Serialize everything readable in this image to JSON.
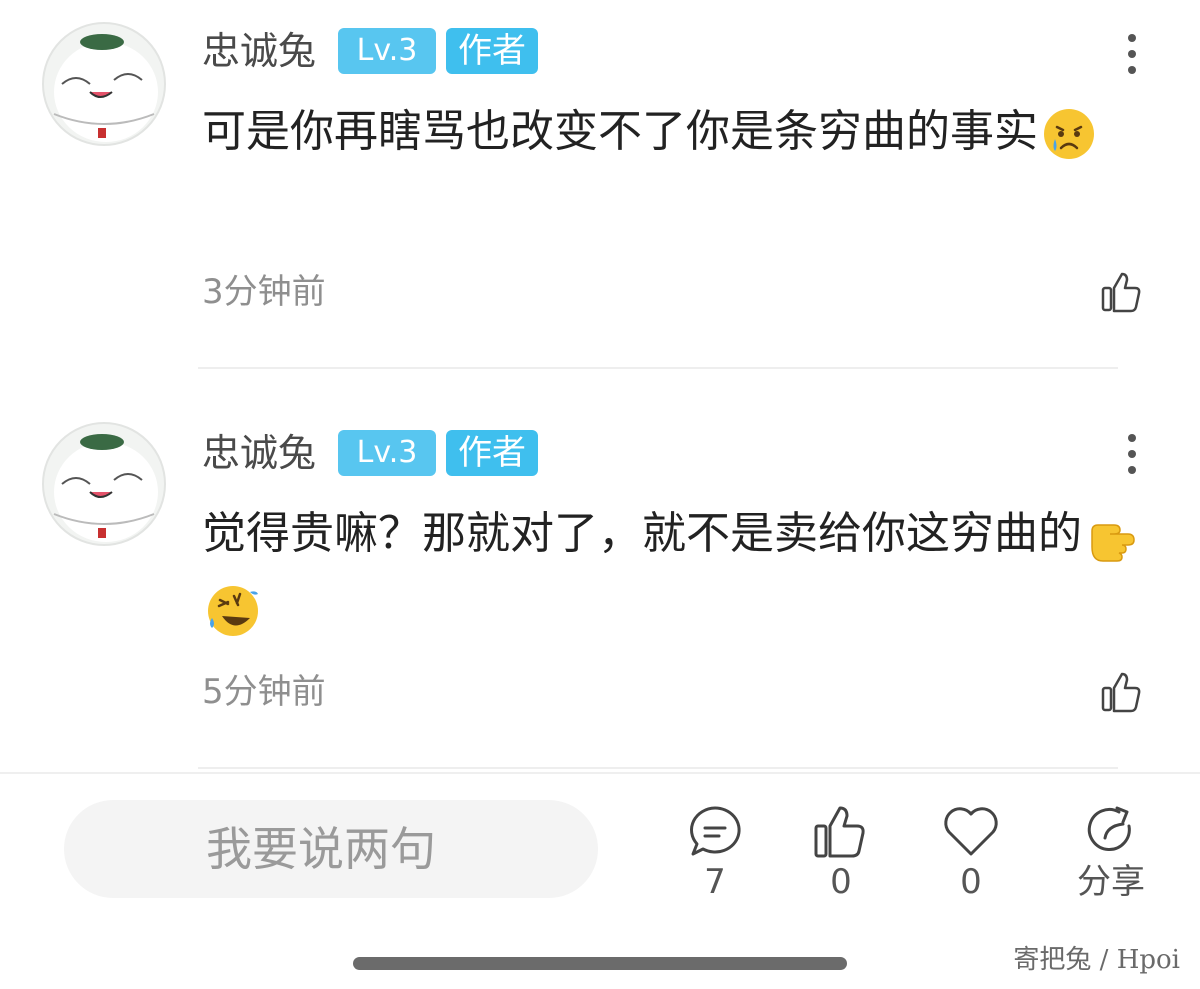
{
  "comments": [
    {
      "username": "忠诚兔",
      "level": "Lv.3",
      "role": "作者",
      "text": "可是你再瞎骂也改变不了你是条穷曲的事实",
      "emoji": [
        "crying-face"
      ],
      "time": "3分钟前"
    },
    {
      "username": "忠诚兔",
      "level": "Lv.3",
      "role": "作者",
      "text": "觉得贵嘛？那就对了，就不是卖给你这穷曲的",
      "emoji": [
        "pointing-hand",
        "rolling-laughing-face"
      ],
      "time": "5分钟前"
    }
  ],
  "bottom_bar": {
    "input_placeholder": "我要说两句",
    "comment_count": "7",
    "like_count": "0",
    "favorite_count": "0",
    "share_label": "分享"
  },
  "watermark": "寄把兔 / Hpoi",
  "colors": {
    "badge": "#3fbfee",
    "emoji_yellow": "#f7c531",
    "emoji_tear": "#4aa3e8"
  }
}
